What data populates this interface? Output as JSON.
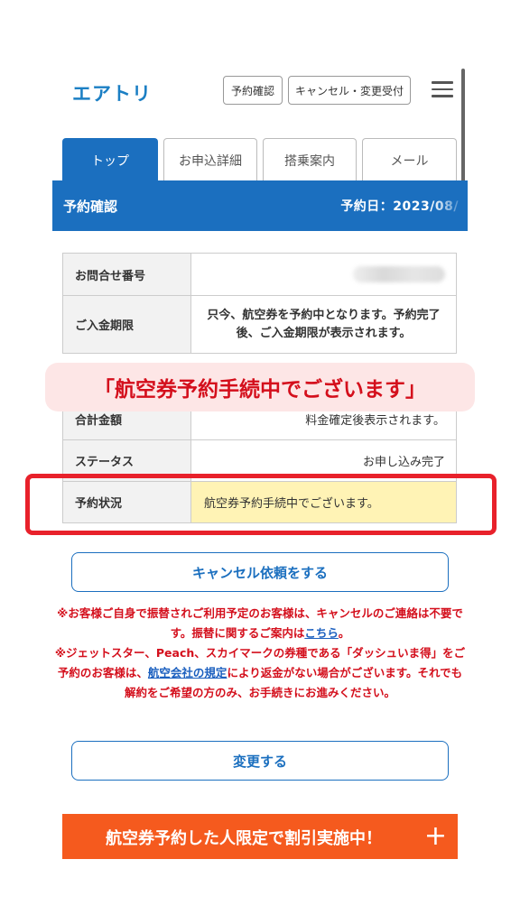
{
  "header": {
    "logo": "エアトリ",
    "btn_confirm": "予約確認",
    "btn_cancel_change": "キャンセル・変更受付",
    "menu_icon": "hamburger-menu-icon"
  },
  "tabs": [
    {
      "label": "トップ",
      "active": true
    },
    {
      "label": "お申込詳細",
      "active": false
    },
    {
      "label": "搭乗案内",
      "active": false
    },
    {
      "label": "メール",
      "active": false
    }
  ],
  "section": {
    "title": "予約確認",
    "date": "予約日：2023/08/"
  },
  "table1": {
    "inquiry_label": "お問合せ番号",
    "deadline_label": "ご入金期限",
    "deadline_value": "只今、航空券を予約中となります。予約完了後、ご入金期限が表示されます。"
  },
  "banner": "「航空券予約手続中でございます」",
  "table2": {
    "total_label": "合計金額",
    "total_value": "料金確定後表示されます。",
    "status_label": "ステータス",
    "status_value": "お申し込み完了",
    "booking_label": "予約状況",
    "booking_value": "航空券予約手続中でございます。"
  },
  "cancel_button": "キャンセル依頼をする",
  "notice": {
    "line1": "※お客様ご自身で振替されご利用予定のお客様は、キャンセルのご連絡は不要です。振替に関するご案内は",
    "link1": "こちら",
    "line1_end": "。",
    "line2": "※ジェットスター、Peach、スカイマークの券種である「ダッシュいま得」をご予約のお客様は、",
    "link2": "航空会社の規定",
    "line3": "により返金がない場合がございます。それでも解約をご希望の方のみ、お手続きにお進みください。"
  },
  "change_button": "変更する",
  "promo": {
    "text": "航空券予約した人限定で割引実施中！",
    "plus": "+"
  },
  "colors": {
    "brand_blue": "#1b6fbf",
    "alert_red": "#d40f1c",
    "promo_orange": "#f55a1e",
    "highlight_yellow": "#fff3b5"
  }
}
